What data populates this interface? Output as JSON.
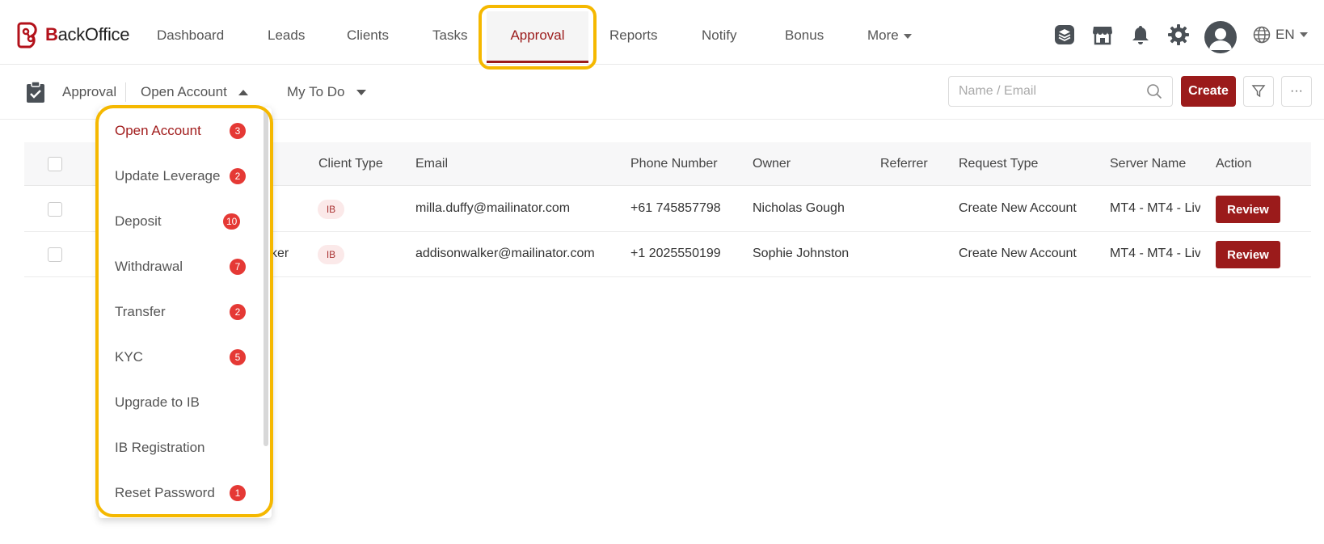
{
  "brand": {
    "name_prefix": "B",
    "name_rest": "ackOffice",
    "accent": "#9b1b1b",
    "highlight": "#f5b800"
  },
  "nav": {
    "items": [
      "Dashboard",
      "Leads",
      "Clients",
      "Tasks",
      "Approval",
      "Reports",
      "Notify",
      "Bonus",
      "More"
    ],
    "active": "Approval",
    "icons": [
      "layers-icon",
      "store-icon",
      "bell-icon",
      "gear-icon",
      "avatar",
      "globe-icon"
    ],
    "language": "EN"
  },
  "subbar": {
    "title": "Approval",
    "category_dropdown": "Open Account",
    "filter_dropdown": "My To Do",
    "search_placeholder": "Name / Email",
    "create_label": "Create",
    "more_label": "···"
  },
  "table": {
    "columns": [
      "Client Type",
      "Email",
      "Phone Number",
      "Owner",
      "Referrer",
      "Request Type",
      "Server Name",
      "Action"
    ],
    "rows": [
      {
        "name_fragment": "",
        "client_type": "IB",
        "email": "milla.duffy@mailinator.com",
        "phone": "+61 745857798",
        "owner": "Nicholas Gough",
        "referrer": "",
        "request_type": "Create New Account",
        "server": "MT4 - MT4 - Liv",
        "action": "Review"
      },
      {
        "name_fragment": "ker",
        "client_type": "IB",
        "email": "addisonwalker@mailinator.com",
        "phone": "+1 2025550199",
        "owner": "Sophie Johnston",
        "referrer": "",
        "request_type": "Create New Account",
        "server": "MT4 - MT4 - Liv",
        "action": "Review"
      }
    ]
  },
  "dropdown": {
    "items": [
      {
        "label": "Open Account",
        "count": "3",
        "active": true
      },
      {
        "label": "Update Leverage",
        "count": "2"
      },
      {
        "label": "Deposit",
        "count": "10"
      },
      {
        "label": "Withdrawal",
        "count": "7"
      },
      {
        "label": "Transfer",
        "count": "2"
      },
      {
        "label": "KYC",
        "count": "5"
      },
      {
        "label": "Upgrade to IB",
        "count": ""
      },
      {
        "label": "IB Registration",
        "count": ""
      },
      {
        "label": "Reset Password",
        "count": "1"
      }
    ]
  }
}
